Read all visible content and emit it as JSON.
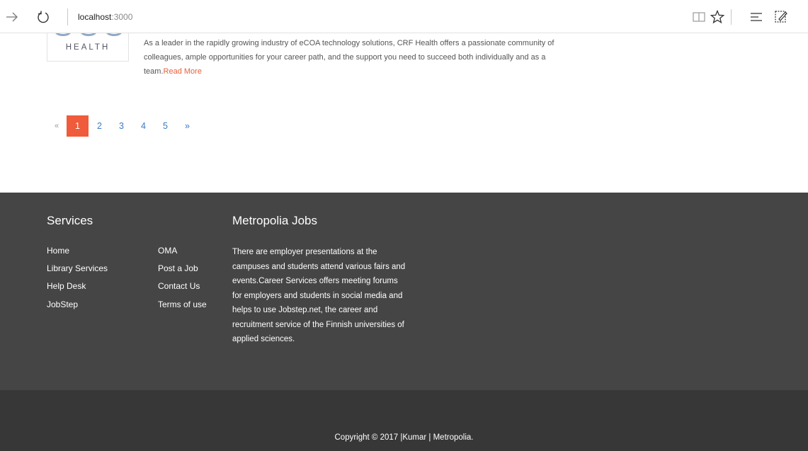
{
  "browser": {
    "url_host": "localhost",
    "url_port": ":3000",
    "icons": [
      "forward-icon",
      "refresh-icon",
      "reading-view-icon",
      "favorite-star-icon",
      "hub-icon",
      "web-note-icon"
    ]
  },
  "listing": {
    "logo_text": "HEALTH",
    "description": "As a leader in the rapidly growing industry of eCOA technology solutions, CRF Health offers a passionate community of colleagues, ample opportunities for your career path, and the support you need to succeed both individually and as a team.",
    "read_more": "Read More"
  },
  "pagination": {
    "prev": "«",
    "pages": [
      "1",
      "2",
      "3",
      "4",
      "5"
    ],
    "next": "»",
    "active": "1"
  },
  "footer": {
    "services_heading": "Services",
    "services_col1": [
      "Home",
      "Library Services",
      "Help Desk",
      "JobStep"
    ],
    "services_col2": [
      "OMA",
      "Post a Job",
      "Contact Us",
      "Terms of use"
    ],
    "about_heading": "Metropolia Jobs",
    "about_text": "There are employer presentations at the campuses and students attend various fairs and events.Career Services offers meeting forums for employers and students in social media and helps to use Jobstep.net, the career and recruitment service of the Finnish universities of applied sciences.",
    "copyright": "Copyright © 2017 |Kumar | Metropolia."
  },
  "colors": {
    "accent": "#ef5b3b",
    "link": "#3a7bc8",
    "footer_top": "#454545",
    "footer_bottom": "#373737"
  }
}
